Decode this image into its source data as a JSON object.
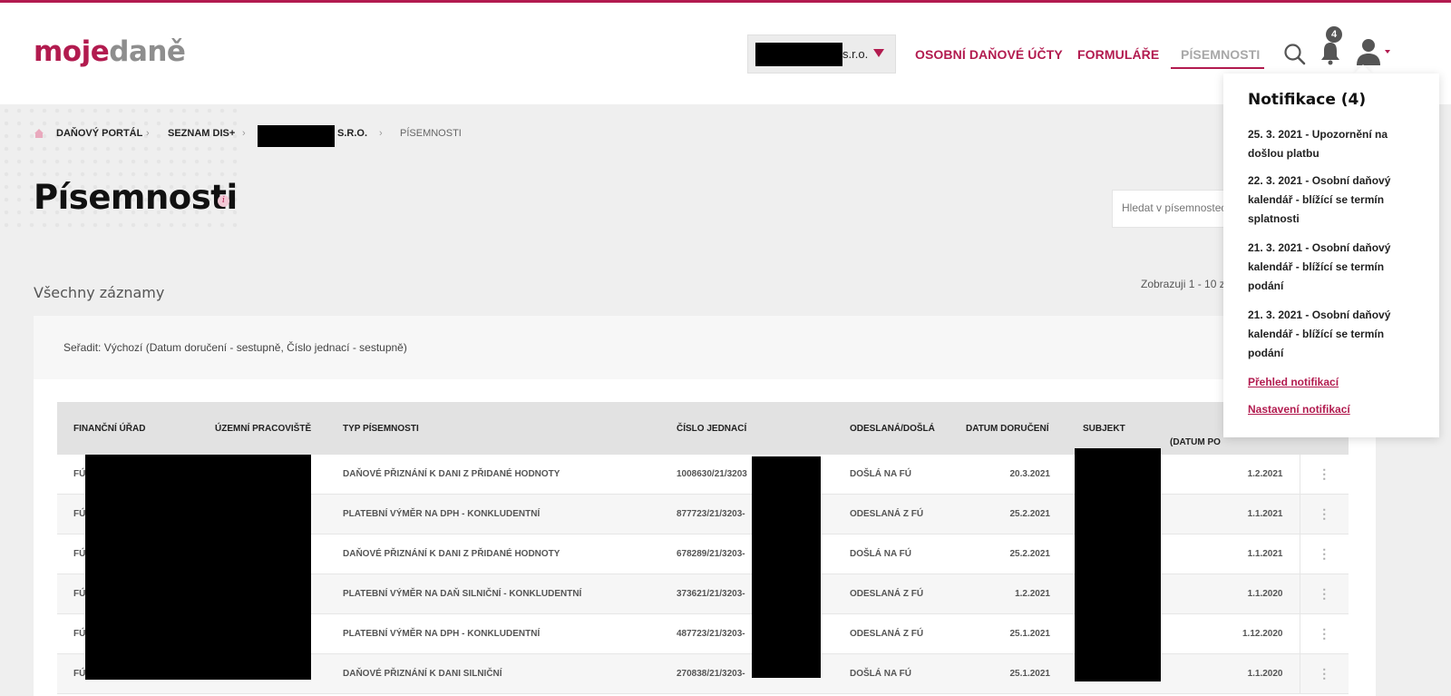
{
  "header": {
    "logo": {
      "part1": "moje",
      "part2": "daně"
    },
    "company_select": {
      "value_suffix": "s.r.o."
    },
    "nav": [
      {
        "label": "OSOBNÍ DAŇOVÉ ÚČTY"
      },
      {
        "label": "FORMULÁŘE"
      },
      {
        "label": "PÍSEMNOSTI"
      }
    ],
    "notification_count": "4",
    "icons": {
      "search": "search-icon",
      "bell": "bell-icon",
      "user": "user-icon"
    }
  },
  "breadcrumb": {
    "home_icon": "home-icon",
    "items": [
      "DAŇOVÝ PORTÁL",
      "SEZNAM DIS+",
      "S.R.O.",
      "PÍSEMNOSTI"
    ],
    "separator": "›"
  },
  "page": {
    "title": "Písemnosti",
    "info_icon": "i",
    "search_placeholder": "Hledat v písemnostech",
    "section_label": "Všechny záznamy",
    "showing_text": "Zobrazuji 1 - 10 z"
  },
  "sort": {
    "label": "Seřadit: Výchozí (Datum doručení - sestupně, Číslo jednací - sestupně)"
  },
  "table": {
    "columns": [
      "FINANČNÍ ÚŘAD",
      "ÚZEMNÍ PRACOVIŠTĚ",
      "TYP PÍSEMNOSTI",
      "ČÍSLO JEDNACÍ",
      "ODESLANÁ/DOŠLÁ",
      "DATUM DORUČENÍ",
      "SUBJEKT",
      "(DATUM PO"
    ],
    "rows": [
      {
        "fu": "FÚ",
        "typ": "DAŇOVÉ PŘIZNÁNÍ K DANI Z PŘIDANÉ HODNOTY",
        "cj": "1008630/21/3203",
        "smer": "DOŠLÁ NA FÚ",
        "doruceni": "20.3.2021",
        "obdobi": "1.2.2021"
      },
      {
        "fu": "FÚ",
        "typ": "PLATEBNÍ VÝMĚR NA DPH - KONKLUDENTNÍ",
        "cj": "877723/21/3203-",
        "smer": "ODESLANÁ Z FÚ",
        "doruceni": "25.2.2021",
        "obdobi": "1.1.2021"
      },
      {
        "fu": "FÚ",
        "typ": "DAŇOVÉ PŘIZNÁNÍ K DANI Z PŘIDANÉ HODNOTY",
        "cj": "678289/21/3203-",
        "smer": "DOŠLÁ NA FÚ",
        "doruceni": "25.2.2021",
        "obdobi": "1.1.2021"
      },
      {
        "fu": "FÚ",
        "typ": "PLATEBNÍ VÝMĚR NA DAŇ SILNIČNÍ - KONKLUDENTNÍ",
        "cj": "373621/21/3203-",
        "smer": "ODESLANÁ Z FÚ",
        "doruceni": "1.2.2021",
        "obdobi": "1.1.2020"
      },
      {
        "fu": "FÚ",
        "typ": "PLATEBNÍ VÝMĚR NA DPH - KONKLUDENTNÍ",
        "cj": "487723/21/3203-",
        "smer": "ODESLANÁ Z FÚ",
        "doruceni": "25.1.2021",
        "obdobi": "1.12.2020"
      },
      {
        "fu": "FÚ",
        "typ": "DAŇOVÉ PŘIZNÁNÍ K DANI SILNIČNÍ",
        "cj": "270838/21/3203-",
        "smer": "DOŠLÁ NA FÚ",
        "doruceni": "25.1.2021",
        "obdobi": "1.1.2020"
      }
    ],
    "row_menu_glyph": "⋮"
  },
  "notifications": {
    "title": "Notifikace (4)",
    "items": [
      "25. 3. 2021 - Upozornění na došlou platbu",
      "22. 3. 2021 - Osobní daňový kalendář - blížící se termín splatnosti",
      "21. 3. 2021 - Osobní daňový kalendář - blížící se termín podání",
      "21. 3. 2021 - Osobní daňový kalendář - blížící se termín podání"
    ],
    "overview_link": "Přehled notifikací",
    "settings_link": "Nastavení notifikací"
  },
  "colors": {
    "accent": "#b21b4f",
    "muted_logo": "#8e8e8e",
    "background": "#efefef"
  }
}
